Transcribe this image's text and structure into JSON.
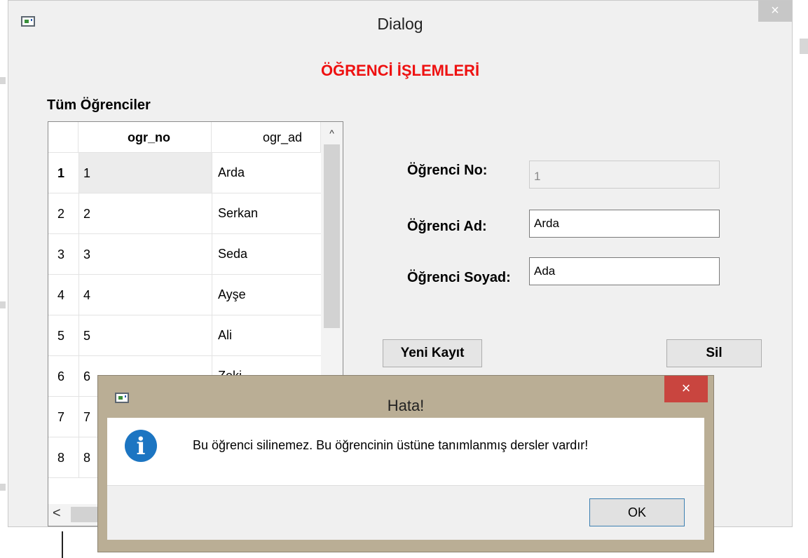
{
  "window": {
    "title": "Dialog",
    "close_glyph": "×",
    "icon": "app-window-icon"
  },
  "heading": "ÖĞRENCİ İŞLEMLERİ",
  "table_label": "Tüm Öğrenciler",
  "table": {
    "columns": [
      "ogr_no",
      "ogr_ad"
    ],
    "rows": [
      {
        "index": "1",
        "ogr_no": "1",
        "ogr_ad": "Arda"
      },
      {
        "index": "2",
        "ogr_no": "2",
        "ogr_ad": "Serkan"
      },
      {
        "index": "3",
        "ogr_no": "3",
        "ogr_ad": "Seda"
      },
      {
        "index": "4",
        "ogr_no": "4",
        "ogr_ad": "Ayşe"
      },
      {
        "index": "5",
        "ogr_no": "5",
        "ogr_ad": "Ali"
      },
      {
        "index": "6",
        "ogr_no": "6",
        "ogr_ad": "Zeki"
      },
      {
        "index": "7",
        "ogr_no": "7",
        "ogr_ad": ""
      },
      {
        "index": "8",
        "ogr_no": "8",
        "ogr_ad": ""
      }
    ],
    "scroll_up_glyph": "^",
    "scroll_left_glyph": "<"
  },
  "form": {
    "no_label": "Öğrenci No:",
    "no_value": "1",
    "ad_label": "Öğrenci Ad:",
    "ad_value": "Arda",
    "soyad_label": "Öğrenci Soyad:",
    "soyad_value": "Ada"
  },
  "buttons": {
    "new": "Yeni Kayıt",
    "delete": "Sil"
  },
  "error_dialog": {
    "title": "Hata!",
    "close_glyph": "×",
    "icon": "info-icon",
    "icon_glyph": "i",
    "message": "Bu öğrenci silinemez. Bu öğrencinin üstüne tanımlanmış dersler vardır!",
    "ok_label": "OK"
  }
}
